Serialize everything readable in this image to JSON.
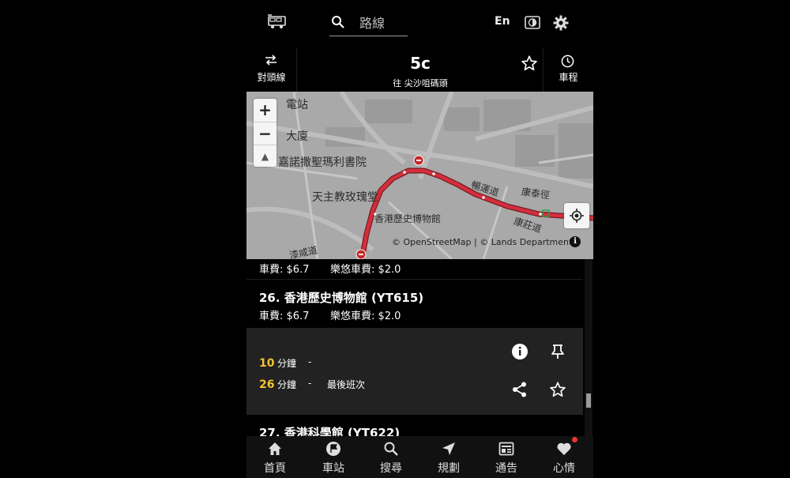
{
  "top_bar": {
    "logo_icon": "bus-logo-icon",
    "search_icon": "search-icon",
    "search_placeholder": "路線",
    "language_button": "En",
    "mode_icon": "contrast-icon",
    "settings_icon": "gear-icon"
  },
  "route_header": {
    "reverse_label": "對頭線",
    "route_number": "5c",
    "destination": "往 尖沙咀碼頭",
    "favourite_icon": "star-outline-icon",
    "timetable_label": "車程"
  },
  "map": {
    "labels": [
      "電站",
      "大廈",
      "嘉諾撒聖瑪利書院",
      "天主教玫瑰堂",
      "香港歷史博物館",
      "暢運道",
      "康泰徑",
      "康莊道",
      "漆咸道"
    ],
    "zoom_in": "+",
    "zoom_out": "−",
    "compass": "▲",
    "attribution": "© OpenStreetMap | © Lands Department",
    "info_icon": "i",
    "route_color": "#d32f3c"
  },
  "stops": [
    {
      "title": "",
      "fare": "車費: $6.7",
      "concession_fare": "樂悠車費: $2.0"
    },
    {
      "title": "26. 香港歷史博物館 (YT615)",
      "fare": "車費: $6.7",
      "concession_fare": "樂悠車費: $2.0"
    },
    {
      "title": "27. 香港科學館 (YT622)"
    }
  ],
  "eta": [
    {
      "minutes": "10",
      "unit": "分鐘",
      "dash": "-",
      "remark": ""
    },
    {
      "minutes": "26",
      "unit": "分鐘",
      "dash": "-",
      "remark": "最後班次"
    }
  ],
  "eta_accent": "#f4c430",
  "bottom_nav": [
    {
      "label": "首頁",
      "icon": "home-icon"
    },
    {
      "label": "車站",
      "icon": "flag-icon"
    },
    {
      "label": "搜尋",
      "icon": "search-icon"
    },
    {
      "label": "規劃",
      "icon": "navigation-icon"
    },
    {
      "label": "通告",
      "icon": "notice-icon"
    },
    {
      "label": "心情",
      "icon": "heart-icon"
    }
  ]
}
